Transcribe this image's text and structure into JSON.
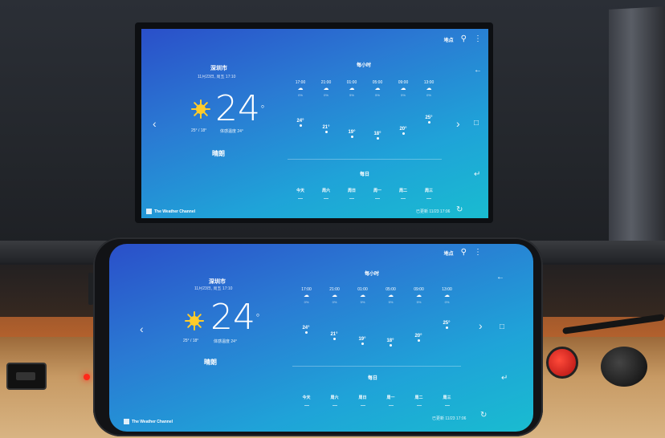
{
  "weather": {
    "place_label": "地点",
    "city": "深圳市",
    "date": "11月23日, 周五 17:10",
    "temperature": "24",
    "degree": "°",
    "minmax": "25° / 18°",
    "feels_like": "体感温度 24°",
    "condition": "晴朗",
    "hourly_title": "每小时",
    "hourly": [
      {
        "time": "17:00",
        "pct": "0%",
        "temp": "24°"
      },
      {
        "time": "21:00",
        "pct": "0%",
        "temp": "21°"
      },
      {
        "time": "01:00",
        "pct": "5%",
        "temp": "19°"
      },
      {
        "time": "05:00",
        "pct": "5%",
        "temp": "18°"
      },
      {
        "time": "09:00",
        "pct": "5%",
        "temp": "20°"
      },
      {
        "time": "13:00",
        "pct": "0%",
        "temp": "25°"
      }
    ],
    "daily_title": "每日",
    "days": [
      "今天",
      "周六",
      "周日",
      "周一",
      "周二",
      "周三"
    ],
    "brand": "The Weather Channel",
    "updated": "已更新 11/23 17:06",
    "icons": {
      "search": "search-icon",
      "more": "more-vert-icon",
      "back": "arrow-back-icon",
      "prev": "chevron-left-icon",
      "next": "chevron-right-icon",
      "window": "window-icon",
      "minimize": "minimize-icon",
      "refresh": "refresh-icon"
    }
  }
}
